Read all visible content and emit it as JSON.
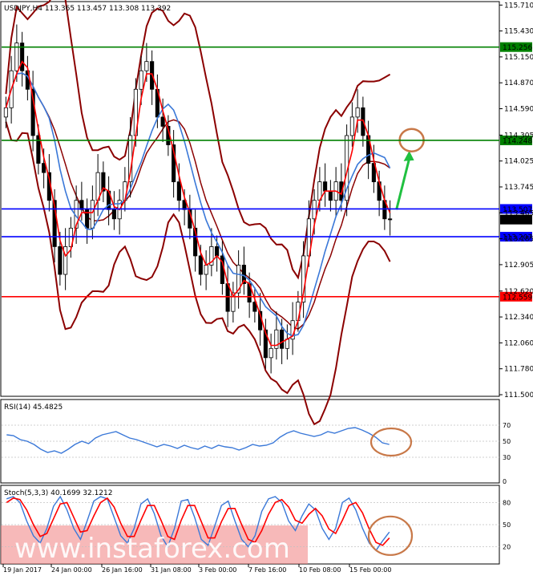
{
  "main": {
    "header": "USDJPY,H4  113.365 113.457 113.308 113.392",
    "ylim": [
      111.5,
      115.73
    ],
    "price_ticks": [
      "115.710",
      "115.430",
      "115.150",
      "114.870",
      "114.590",
      "114.305",
      "114.025",
      "113.745",
      "113.465",
      "113.185",
      "112.905",
      "112.620",
      "112.340",
      "112.060",
      "111.780",
      "111.500"
    ],
    "levels": [
      {
        "value": 115.256,
        "label": "115.256",
        "color": "#008000",
        "kind": "green"
      },
      {
        "value": 114.248,
        "label": "114.248",
        "color": "#008000",
        "kind": "green"
      },
      {
        "value": 113.507,
        "label": "113.507",
        "color": "#0000ff",
        "kind": "blue"
      },
      {
        "value": 113.207,
        "label": "113.207",
        "color": "#0000ff",
        "kind": "blue"
      },
      {
        "value": 112.559,
        "label": "112.559",
        "color": "#ff0000",
        "kind": "red"
      }
    ],
    "current_price": {
      "value": 113.392,
      "label": "113.392",
      "color": "#000000"
    }
  },
  "rsi": {
    "header": "RSI(14) 45.4825",
    "ylim": [
      0,
      100
    ],
    "ticks": [
      "70",
      "50",
      "30",
      "0"
    ]
  },
  "stoch": {
    "header": "Stoch(5,3,3) 40.1699 32.1212",
    "ylim": [
      0,
      100
    ],
    "ticks": [
      "80",
      "50",
      "20"
    ]
  },
  "x_labels": [
    "19 Jan 2017",
    "24 Jan 00:00",
    "26 Jan 16:00",
    "31 Jan 08:00",
    "3 Feb 00:00",
    "7 Feb 16:00",
    "10 Feb 08:00",
    "15 Feb 00:00"
  ],
  "watermark": "www.instaforex.com",
  "colors": {
    "candle": "#000000",
    "bb": "#8b0000",
    "fast_ma": "#ff0000",
    "slow_ma": "#3a78d8",
    "rsi": "#3a78d8",
    "stoch_k": "#3a78d8",
    "stoch_d": "#ff0000",
    "arrow": "#20c040",
    "circle": "#c87848"
  },
  "chart_data": [
    {
      "type": "candlestick",
      "title": "USDJPY,H4",
      "ylim": [
        111.5,
        115.73
      ],
      "series": [
        {
          "values": [
            114.6,
            115.0,
            115.3,
            115.0,
            114.8,
            114.3,
            114.0,
            113.9,
            113.6,
            113.1,
            112.8,
            113.1,
            113.3,
            113.6,
            113.5,
            113.3,
            113.6,
            113.9,
            113.7,
            113.5,
            113.4,
            113.6,
            113.8,
            114.3,
            114.8,
            115.0,
            115.1,
            114.8,
            114.5,
            114.4,
            114.2,
            113.8,
            113.6,
            113.5,
            113.3,
            113.0,
            112.8,
            112.9,
            113.1,
            113.0,
            112.7,
            112.4,
            112.6,
            112.9,
            112.7,
            112.5,
            112.4,
            112.2,
            111.9,
            112.0,
            112.2,
            112.0,
            112.1,
            112.3,
            112.5,
            113.0,
            113.4,
            113.6,
            113.8,
            113.7,
            113.6,
            113.8,
            113.6,
            114.3,
            114.5,
            114.6,
            114.3,
            114.0,
            113.8,
            113.6,
            113.4,
            113.39
          ]
        }
      ]
    },
    {
      "type": "line",
      "title": "RSI(14) 45.4825",
      "ylim": [
        0,
        100
      ],
      "series": [
        {
          "values": [
            58,
            57,
            52,
            50,
            46,
            40,
            36,
            38,
            35,
            40,
            46,
            50,
            47,
            54,
            58,
            60,
            62,
            58,
            54,
            52,
            49,
            46,
            43,
            46,
            44,
            41,
            45,
            42,
            40,
            44,
            41,
            45,
            43,
            42,
            39,
            42,
            46,
            44,
            45,
            48,
            55,
            60,
            63,
            60,
            58,
            56,
            58,
            62,
            60,
            63,
            66,
            67,
            64,
            60,
            55,
            48,
            46
          ]
        }
      ]
    },
    {
      "type": "line",
      "title": "Stoch(5,3,3) 40.1699 32.1212",
      "ylim": [
        0,
        100
      ],
      "series": [
        {
          "values": [
            85,
            88,
            80,
            55,
            35,
            25,
            45,
            75,
            88,
            70,
            45,
            30,
            55,
            82,
            88,
            85,
            60,
            35,
            25,
            45,
            78,
            85,
            65,
            35,
            20,
            45,
            82,
            84,
            60,
            30,
            22,
            48,
            76,
            82,
            55,
            30,
            20,
            35,
            68,
            85,
            88,
            80,
            55,
            42,
            62,
            78,
            70,
            45,
            30,
            45,
            80,
            86,
            70,
            45,
            25,
            15,
            28,
            40
          ]
        },
        {
          "values": [
            80,
            86,
            84,
            70,
            50,
            34,
            38,
            58,
            78,
            80,
            60,
            40,
            42,
            62,
            80,
            86,
            74,
            52,
            34,
            34,
            56,
            76,
            76,
            56,
            34,
            30,
            56,
            76,
            76,
            54,
            32,
            32,
            54,
            72,
            72,
            50,
            30,
            26,
            42,
            64,
            80,
            84,
            74,
            56,
            52,
            64,
            72,
            62,
            44,
            38,
            56,
            76,
            80,
            66,
            44,
            26,
            22,
            32
          ]
        }
      ]
    }
  ]
}
